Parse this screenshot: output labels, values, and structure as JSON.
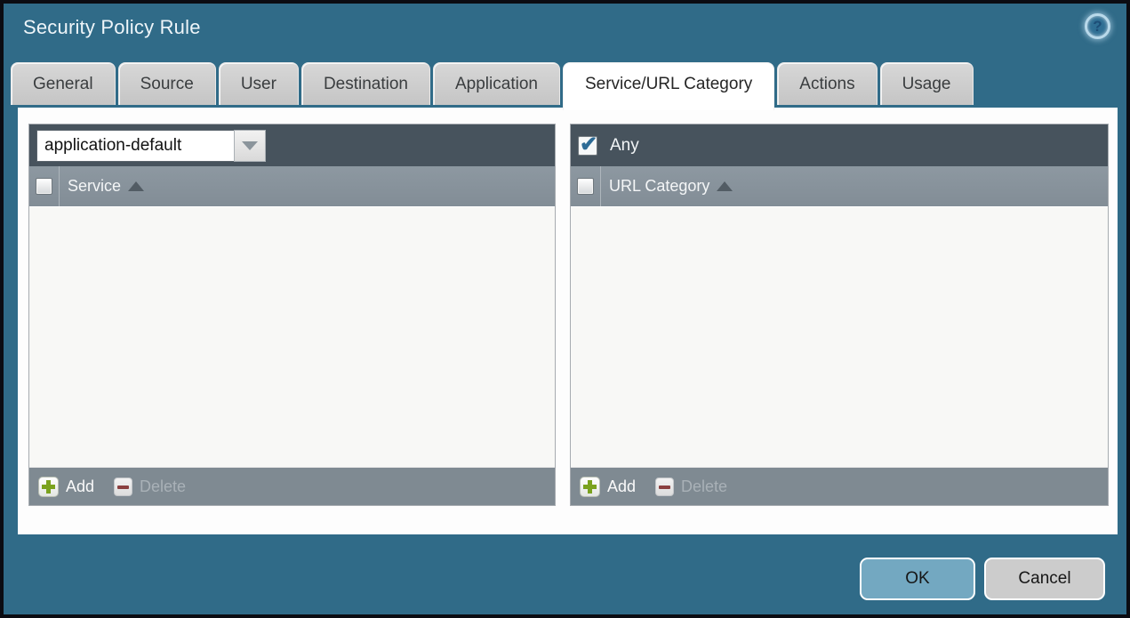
{
  "window": {
    "title": "Security Policy Rule",
    "help_glyph": "?"
  },
  "tabs": [
    {
      "label": "General",
      "active": false
    },
    {
      "label": "Source",
      "active": false
    },
    {
      "label": "User",
      "active": false
    },
    {
      "label": "Destination",
      "active": false
    },
    {
      "label": "Application",
      "active": false
    },
    {
      "label": "Service/URL Category",
      "active": true
    },
    {
      "label": "Actions",
      "active": false
    },
    {
      "label": "Usage",
      "active": false
    }
  ],
  "service_panel": {
    "dropdown_value": "application-default",
    "column_header": "Service",
    "rows": [],
    "add_label": "Add",
    "delete_label": "Delete",
    "delete_enabled": false
  },
  "url_category_panel": {
    "any_label": "Any",
    "any_checked": true,
    "column_header": "URL Category",
    "rows": [],
    "add_label": "Add",
    "delete_label": "Delete",
    "delete_enabled": false
  },
  "footer": {
    "ok_label": "OK",
    "cancel_label": "Cancel"
  },
  "colors": {
    "window_teal": "#306b88",
    "panel_toolbar": "#47535d",
    "column_header": "#87929b",
    "panel_footer": "#7f8a92",
    "ok_button": "#73a8c1",
    "cancel_button": "#cccccc",
    "add_icon_green": "#7aa21e",
    "delete_icon_red": "#8b4040",
    "check_blue": "#2d6b96"
  }
}
